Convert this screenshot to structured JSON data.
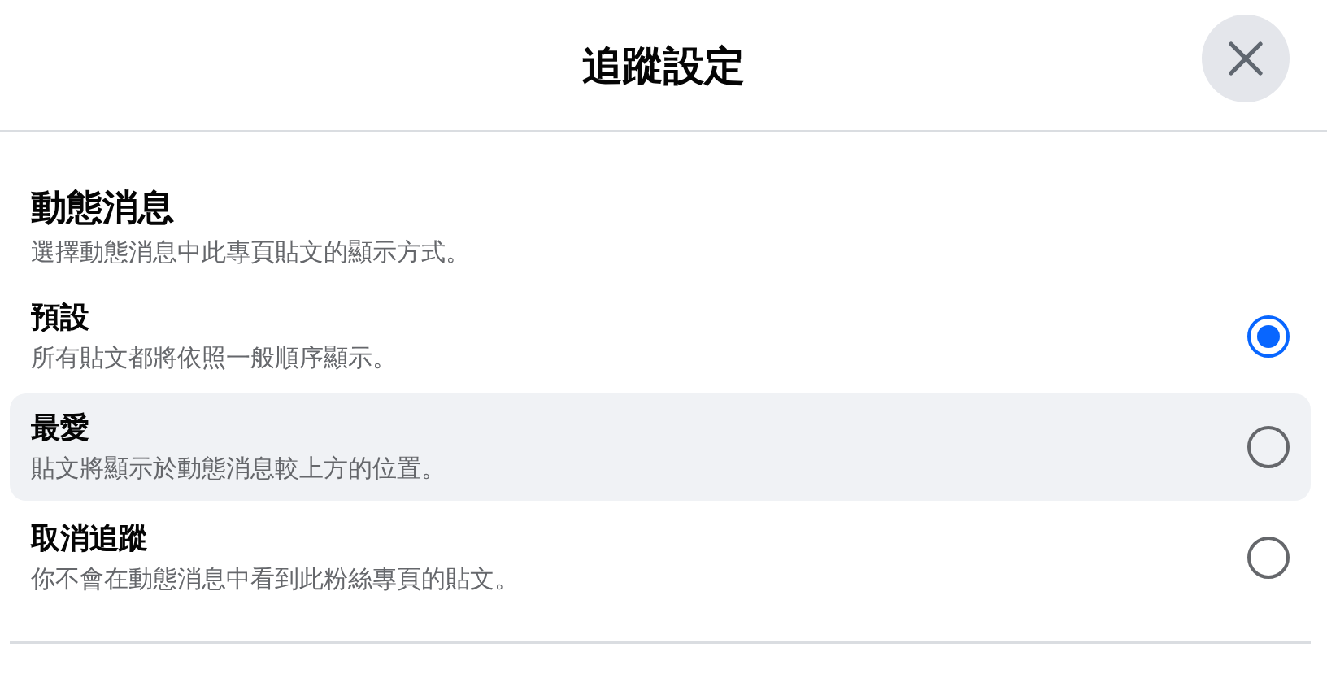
{
  "dialog": {
    "title": "追蹤設定"
  },
  "section": {
    "heading": "動態消息",
    "description": "選擇動態消息中此專頁貼文的顯示方式。"
  },
  "options": [
    {
      "label": "預設",
      "description": "所有貼文都將依照一般順序顯示。",
      "selected": true,
      "hovered": false
    },
    {
      "label": "最愛",
      "description": "貼文將顯示於動態消息較上方的位置。",
      "selected": false,
      "hovered": true
    },
    {
      "label": "取消追蹤",
      "description": "你不會在動態消息中看到此粉絲專頁的貼文。",
      "selected": false,
      "hovered": false
    }
  ]
}
